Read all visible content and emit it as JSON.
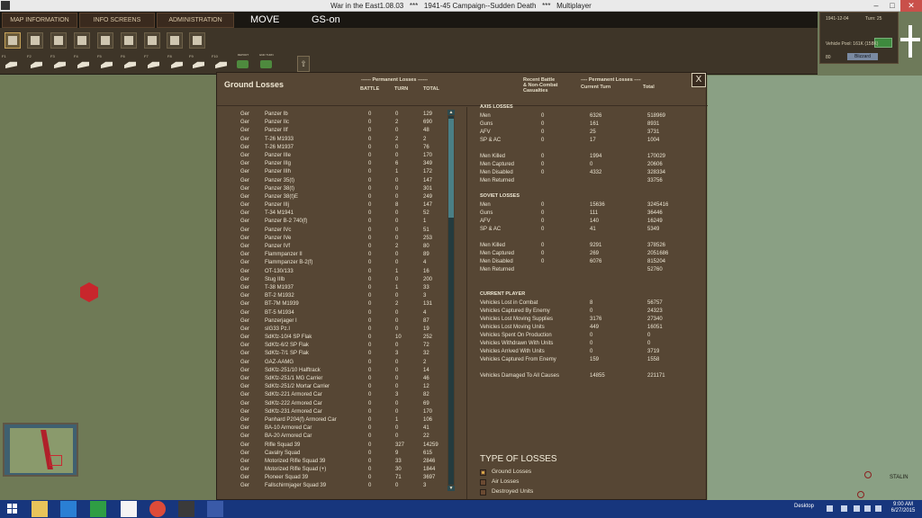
{
  "window": {
    "title": "War in the East1.08.03   ***   1941-45 Campaign--Sudden Death   ***   Multiplayer"
  },
  "menu": {
    "tabs": [
      "MAP INFORMATION",
      "INFO SCREENS",
      "ADMINISTRATION"
    ],
    "mode": "MOVE",
    "status": "GS-on"
  },
  "toolbar": {
    "fkeys": [
      "F1",
      "F2",
      "F3",
      "F4",
      "F5",
      "F6",
      "F7",
      "F8",
      "F9",
      "F10"
    ],
    "report_label": "REPORT",
    "end_turn_label": "END TURN"
  },
  "info_panel": {
    "date": "1941-12-04",
    "turn": "Turn: 25",
    "vehicle_pool": "Vehicle Pool: 161K (158K)",
    "value": "80",
    "weather": "Blizzard"
  },
  "map": {
    "city_label": "STALIN"
  },
  "dialog": {
    "title": "Ground Losses",
    "permanent_losses_header": "------ Permanent Losses ------",
    "col_battle": "BATTLE",
    "col_turn": "TURN",
    "col_total": "TOTAL",
    "recent_header": "Recent Battle\n& Non-Combat\nCasualties",
    "perm_losses_right": "---- Permanent Losses ----",
    "col_current_turn": "Current Turn",
    "col_total_right": "Total",
    "close": "X",
    "units": [
      [
        "Ger",
        "Panzer Ib",
        "0",
        "0",
        "129"
      ],
      [
        "Ger",
        "Panzer IIc",
        "0",
        "2",
        "690"
      ],
      [
        "Ger",
        "Panzer IIf",
        "0",
        "0",
        "48"
      ],
      [
        "Ger",
        "T-26 M1933",
        "0",
        "2",
        "2"
      ],
      [
        "Ger",
        "T-26 M1937",
        "0",
        "0",
        "76"
      ],
      [
        "Ger",
        "Panzer IIIe",
        "0",
        "0",
        "170"
      ],
      [
        "Ger",
        "Panzer IIIg",
        "0",
        "6",
        "349"
      ],
      [
        "Ger",
        "Panzer IIIh",
        "0",
        "1",
        "172"
      ],
      [
        "Ger",
        "Panzer 35(t)",
        "0",
        "0",
        "147"
      ],
      [
        "Ger",
        "Panzer 38(t)",
        "0",
        "0",
        "301"
      ],
      [
        "Ger",
        "Panzer 38(t)E",
        "0",
        "0",
        "249"
      ],
      [
        "Ger",
        "Panzer IIIj",
        "0",
        "8",
        "147"
      ],
      [
        "Ger",
        "T-34 M1941",
        "0",
        "0",
        "52"
      ],
      [
        "Ger",
        "Panzer B-2 740(f)",
        "0",
        "0",
        "1"
      ],
      [
        "Ger",
        "Panzer IVc",
        "0",
        "0",
        "51"
      ],
      [
        "Ger",
        "Panzer IVe",
        "0",
        "0",
        "253"
      ],
      [
        "Ger",
        "Panzer IVf",
        "0",
        "2",
        "80"
      ],
      [
        "Ger",
        "Flammpanzer II",
        "0",
        "0",
        "89"
      ],
      [
        "Ger",
        "Flammpanzer B-2(f)",
        "0",
        "0",
        "4"
      ],
      [
        "Ger",
        "OT-130/133",
        "0",
        "1",
        "16"
      ],
      [
        "Ger",
        "Stug IIIb",
        "0",
        "0",
        "200"
      ],
      [
        "Ger",
        "T-38 M1937",
        "0",
        "1",
        "33"
      ],
      [
        "Ger",
        "BT-2 M1932",
        "0",
        "0",
        "3"
      ],
      [
        "Ger",
        "BT-7M M1939",
        "0",
        "2",
        "131"
      ],
      [
        "Ger",
        "BT-5 M1934",
        "0",
        "0",
        "4"
      ],
      [
        "Ger",
        "Panzerjager I",
        "0",
        "0",
        "87"
      ],
      [
        "Ger",
        "sIG33 Pz.I",
        "0",
        "0",
        "19"
      ],
      [
        "Ger",
        "SdKfz-10/4 SP Flak",
        "0",
        "10",
        "252"
      ],
      [
        "Ger",
        "SdKfz-6/2 SP Flak",
        "0",
        "0",
        "72"
      ],
      [
        "Ger",
        "SdKfz-7/1 SP Flak",
        "0",
        "3",
        "32"
      ],
      [
        "Ger",
        "GAZ-AAMG",
        "0",
        "0",
        "2"
      ],
      [
        "Ger",
        "SdKfz-251/10 Halftrack",
        "0",
        "0",
        "14"
      ],
      [
        "Ger",
        "SdKfz-251/1 MG Carrier",
        "0",
        "0",
        "46"
      ],
      [
        "Ger",
        "SdKfz-251/2 Mortar Carrier",
        "0",
        "0",
        "12"
      ],
      [
        "Ger",
        "SdKfz-221 Armored Car",
        "0",
        "3",
        "82"
      ],
      [
        "Ger",
        "SdKfz-222 Armored Car",
        "0",
        "0",
        "69"
      ],
      [
        "Ger",
        "SdKfz-231 Armored Car",
        "0",
        "0",
        "170"
      ],
      [
        "Ger",
        "Panhard P204(f) Armored Car",
        "0",
        "1",
        "106"
      ],
      [
        "Ger",
        "BA-10 Armored Car",
        "0",
        "0",
        "41"
      ],
      [
        "Ger",
        "BA-20 Armored Car",
        "0",
        "0",
        "22"
      ],
      [
        "Ger",
        "Rifle Squad 39",
        "0",
        "327",
        "14259"
      ],
      [
        "Ger",
        "Cavalry Squad",
        "0",
        "9",
        "615"
      ],
      [
        "Ger",
        "Motorized Rifle Squad 39",
        "0",
        "33",
        "2846"
      ],
      [
        "Ger",
        "Motorized Rifle Squad (+)",
        "0",
        "30",
        "1844"
      ],
      [
        "Ger",
        "Pioneer Squad 39",
        "0",
        "71",
        "3697"
      ],
      [
        "Ger",
        "Fallschirmjager Squad 39",
        "0",
        "0",
        "3"
      ]
    ],
    "axis": {
      "title": "AXIS LOSSES",
      "rows": [
        [
          "Men",
          "0",
          "6326",
          "518969"
        ],
        [
          "Guns",
          "0",
          "161",
          "8931"
        ],
        [
          "AFV",
          "0",
          "25",
          "3731"
        ],
        [
          "SP & AC",
          "0",
          "17",
          "1004"
        ]
      ],
      "rows2": [
        [
          "Men Killed",
          "0",
          "1994",
          "170029"
        ],
        [
          "Men Captured",
          "0",
          "0",
          "20606"
        ],
        [
          "Men Disabled",
          "0",
          "4332",
          "328334"
        ],
        [
          "Men Returned",
          "",
          "",
          "33756"
        ]
      ]
    },
    "soviet": {
      "title": "SOVIET LOSSES",
      "rows": [
        [
          "Men",
          "0",
          "15636",
          "3245416"
        ],
        [
          "Guns",
          "0",
          "111",
          "36446"
        ],
        [
          "AFV",
          "0",
          "140",
          "16249"
        ],
        [
          "SP & AC",
          "0",
          "41",
          "5349"
        ]
      ],
      "rows2": [
        [
          "Men Killed",
          "0",
          "9291",
          "378526"
        ],
        [
          "Men Captured",
          "0",
          "269",
          "2051686"
        ],
        [
          "Men Disabled",
          "0",
          "6076",
          "815204"
        ],
        [
          "Men Returned",
          "",
          "",
          "52760"
        ]
      ]
    },
    "current_player": {
      "title": "CURRENT PLAYER",
      "rows": [
        [
          "Vehicles Lost in Combat",
          "8",
          "56757"
        ],
        [
          "Vehicles Captured By Enemy",
          "0",
          "24323"
        ],
        [
          "Vehicles Lost Moving Supplies",
          "3176",
          "27340"
        ],
        [
          "Vehicles Lost Moving Units",
          "449",
          "16051"
        ],
        [
          "Vehicles Spent On Production",
          "0",
          "0"
        ],
        [
          "Vehicles Withdrawn With Units",
          "0",
          "0"
        ],
        [
          "Vehicles Arrived With Units",
          "0",
          "3719"
        ],
        [
          "Vehicles Captured From Enemy",
          "159",
          "1558"
        ]
      ],
      "damaged": [
        "Vehicles Damaged To All Causes",
        "14855",
        "221171"
      ]
    },
    "type_of_losses": {
      "title": "TYPE OF LOSSES",
      "options": [
        "Ground Losses",
        "Air Losses",
        "Destroyed Units"
      ],
      "selected": "Ground Losses"
    }
  },
  "taskbar": {
    "desktop_label": "Desktop",
    "time": "9:00 AM",
    "date": "6/27/2015"
  }
}
